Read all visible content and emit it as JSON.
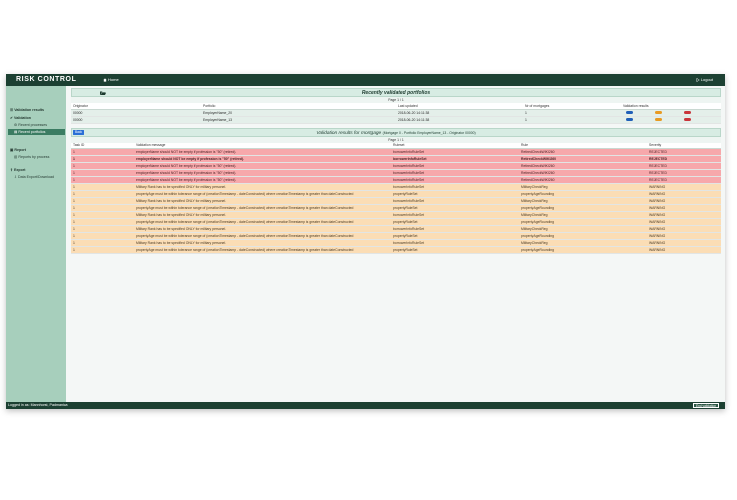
{
  "header": {
    "brand": "RISK CONTROL",
    "home_label": "Home",
    "logout_label": "Logout"
  },
  "sidebar": {
    "items": [
      {
        "label": "Validation results",
        "type": "group",
        "icon": "list-icon"
      },
      {
        "label": "Validation",
        "type": "group",
        "icon": "check-icon"
      },
      {
        "label": "Recent processes",
        "type": "sub",
        "icon": "gear-icon"
      },
      {
        "label": "Recent portfolios",
        "type": "sub-active",
        "icon": "briefcase-icon"
      },
      {
        "label": "Report",
        "type": "group",
        "icon": "report-icon"
      },
      {
        "label": "Reports by process",
        "type": "sub",
        "icon": "chart-icon"
      },
      {
        "label": "Export",
        "type": "group",
        "icon": "export-icon"
      },
      {
        "label": "Data Export/Download",
        "type": "sub",
        "icon": "download-icon"
      }
    ]
  },
  "portfolios": {
    "title": "Recently validated portfolios",
    "pager": "Page 1 / 1",
    "columns": [
      "Originator",
      "Portfolio",
      "Last updated",
      "Nr of mortgages",
      "Validation results"
    ],
    "rows": [
      {
        "originator": "00000",
        "portfolio": "EmployerName_20",
        "updated": "2018-06-20 14:11:38",
        "count": "1"
      },
      {
        "originator": "00000",
        "portfolio": "EmployerName_13",
        "updated": "2018-06-20 14:11:38",
        "count": "1"
      }
    ]
  },
  "validation": {
    "back_label": "Back",
    "title": "Validation results for mortgage",
    "subtitle": "(Mortgage 0 - Portfolio EmployerName_13 - Originator 00000)",
    "pager": "Page 1 / 1",
    "columns": [
      "Task ID",
      "Validation message",
      "Ruleset",
      "Rule",
      "Severity"
    ],
    "rows": [
      {
        "task": "1",
        "message": "employerName should NOT be empty if profession is \"50\" (retired).",
        "ruleset": "borrowerInfoRuleSet",
        "rule": "RetiredCheckWIKI260",
        "severity": "REJECTED",
        "level": "rejected"
      },
      {
        "task": "1",
        "message": "employerName should NOT be empty if profession is \"50\" (retired).",
        "ruleset": "borrowerInfoRuleSet",
        "rule": "RetiredCheckWIKI260",
        "severity": "REJECTED",
        "level": "rejected-bold"
      },
      {
        "task": "1",
        "message": "employerName should NOT be empty if profession is \"50\" (retired).",
        "ruleset": "borrowerInfoRuleSet",
        "rule": "RetiredCheckWIKI260",
        "severity": "REJECTED",
        "level": "rejected"
      },
      {
        "task": "1",
        "message": "employerName should NOT be empty if profession is \"50\" (retired).",
        "ruleset": "borrowerInfoRuleSet",
        "rule": "RetiredCheckWIKI260",
        "severity": "REJECTED",
        "level": "rejected"
      },
      {
        "task": "1",
        "message": "employerName should NOT be empty if profession is \"50\" (retired).",
        "ruleset": "borrowerInfoRuleSet",
        "rule": "RetiredCheckWIKI260",
        "severity": "REJECTED",
        "level": "rejected"
      },
      {
        "task": "1",
        "message": "Military Rank has to be specified ONLY for military personel.",
        "ruleset": "borrowerInfoRuleSet",
        "rule": "MilitaryCheckReg",
        "severity": "WARNING",
        "level": "warning"
      },
      {
        "task": "1",
        "message": "propertyAge must be within tolerance range of (creationTimestamp - dateConstructed) where creationTimestamp is greater than dateConstructed",
        "ruleset": "propertyRuleSet",
        "rule": "propertyAgeRounding",
        "severity": "WARNING",
        "level": "warning"
      },
      {
        "task": "1",
        "message": "Military Rank has to be specified ONLY for military personel.",
        "ruleset": "borrowerInfoRuleSet",
        "rule": "MilitaryCheckReg",
        "severity": "WARNING",
        "level": "warning"
      },
      {
        "task": "1",
        "message": "propertyAge must be within tolerance range of (creationTimestamp - dateConstructed) where creationTimestamp is greater than dateConstructed",
        "ruleset": "propertyRuleSet",
        "rule": "propertyAgeRounding",
        "severity": "WARNING",
        "level": "warning"
      },
      {
        "task": "1",
        "message": "Military Rank has to be specified ONLY for military personel.",
        "ruleset": "borrowerInfoRuleSet",
        "rule": "MilitaryCheckReg",
        "severity": "WARNING",
        "level": "warning"
      },
      {
        "task": "1",
        "message": "propertyAge must be within tolerance range of (creationTimestamp - dateConstructed) where creationTimestamp is greater than dateConstructed",
        "ruleset": "propertyRuleSet",
        "rule": "propertyAgeRounding",
        "severity": "WARNING",
        "level": "warning"
      },
      {
        "task": "1",
        "message": "Military Rank has to be specified ONLY for military personel.",
        "ruleset": "borrowerInfoRuleSet",
        "rule": "MilitaryCheckReg",
        "severity": "WARNING",
        "level": "warning"
      },
      {
        "task": "1",
        "message": "propertyAge must be within tolerance range of (creationTimestamp - dateConstructed) where creationTimestamp is greater than dateConstructed",
        "ruleset": "propertyRuleSet",
        "rule": "propertyAgeRounding",
        "severity": "WARNING",
        "level": "warning"
      },
      {
        "task": "1",
        "message": "Military Rank has to be specified ONLY for military personel.",
        "ruleset": "borrowerInfoRuleSet",
        "rule": "MilitaryCheckReg",
        "severity": "WARNING",
        "level": "warning"
      },
      {
        "task": "1",
        "message": "propertyAge must be within tolerance range of (creationTimestamp - dateConstructed) where creationTimestamp is greater than dateConstructed",
        "ruleset": "propertyRuleSet",
        "rule": "propertyAgeRounding",
        "severity": "WARNING",
        "level": "warning"
      }
    ]
  },
  "footer": {
    "user_text": "Logged in as: Mannhorst, Padmanica",
    "end_label": "End validation"
  },
  "colors": {
    "header_bg": "#1c4032",
    "sidebar_bg": "#a7cfbc",
    "rejected_bg": "#f7a8ab",
    "warning_bg": "#fbddb5",
    "pill_blue": "#1f5fb8",
    "pill_orange": "#e89a22",
    "pill_red": "#c9353b"
  }
}
